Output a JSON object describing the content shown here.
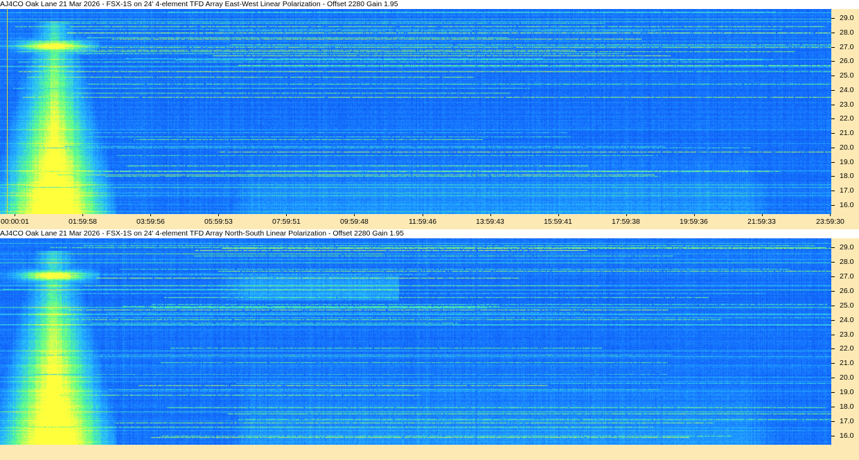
{
  "panels": [
    {
      "id": "ew",
      "title": "AJ4CO Oak Lane 21 Mar 2026 - FSX-1S on 24' 4-element TFD Array East-West Linear Polarization  -  Offset 2280  Gain 1.95"
    },
    {
      "id": "ns",
      "title": "AJ4CO Oak Lane 21 Mar 2026 - FSX-1S on 24' 4-element TFD Array North-South Linear Polarization  -  Offset 2280  Gain 1.95"
    }
  ],
  "x_tick_labels": [
    "00:00:01",
    "01:59:58",
    "03:59:56",
    "05:59:53",
    "07:59:51",
    "09:59:48",
    "11:59:46",
    "13:59:43",
    "15:59:41",
    "17:59:38",
    "19:59:36",
    "21:59:33",
    "23:59:30"
  ],
  "chart_data": [
    {
      "type": "heatmap",
      "title": "AJ4CO Oak Lane 21 Mar 2026 - FSX-1S on 24' 4-element TFD Array East-West Linear Polarization  -  Offset 2280  Gain 1.95",
      "x_axis": {
        "start": "00:00:01",
        "end": "23:59:30",
        "ticks": [
          "00:00:01",
          "01:59:58",
          "03:59:56",
          "05:59:53",
          "07:59:51",
          "09:59:48",
          "11:59:46",
          "13:59:43",
          "15:59:41",
          "17:59:38",
          "19:59:36",
          "21:59:33",
          "23:59:30"
        ]
      },
      "y_axis": {
        "range": [
          15.5,
          29.5
        ],
        "ticks": [
          29.0,
          28.0,
          27.0,
          26.0,
          25.0,
          24.0,
          23.0,
          22.0,
          21.0,
          20.0,
          19.0,
          18.0,
          17.0,
          16.0
        ],
        "position": "right"
      }
    },
    {
      "type": "heatmap",
      "title": "AJ4CO Oak Lane 21 Mar 2026 - FSX-1S on 24' 4-element TFD Array North-South Linear Polarization  -  Offset 2280  Gain 1.95",
      "x_axis": {
        "start": "00:00:01",
        "end": "23:59:30"
      },
      "y_axis": {
        "range": [
          15.5,
          29.5
        ],
        "ticks": [
          29.0,
          28.0,
          27.0,
          26.0,
          25.0,
          24.0,
          23.0,
          22.0,
          21.0,
          20.0,
          19.0,
          18.0,
          17.0,
          16.0
        ],
        "position": "right"
      }
    }
  ],
  "y_tick_labels": [
    "29.0",
    "28.0",
    "27.0",
    "26.0",
    "25.0",
    "24.0",
    "23.0",
    "22.0",
    "21.0",
    "20.0",
    "19.0",
    "18.0",
    "17.0",
    "16.0"
  ],
  "colors": {
    "axis_bg": "#fde9b4",
    "marker": "#d8d838",
    "spectrum_dark": "#000010",
    "spectrum_blue": "#0a3cff",
    "spectrum_hot": "#ffff40"
  }
}
